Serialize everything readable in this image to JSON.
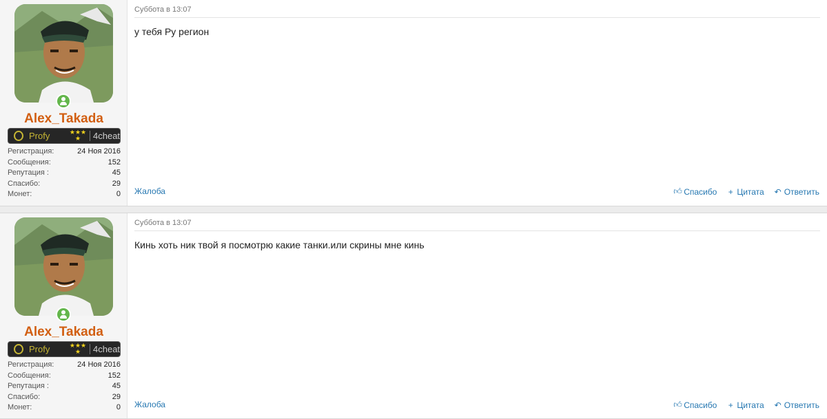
{
  "posts": [
    {
      "user": {
        "name": "Alex_Takada",
        "badge": {
          "rank": "Profy",
          "stars": "★★★",
          "star2": "★",
          "site": "4cheat"
        },
        "stats": [
          {
            "key": "Регистрация:",
            "value": "24 Ноя 2016"
          },
          {
            "key": "Сообщения:",
            "value": "152"
          },
          {
            "key": "Репутация :",
            "value": "45"
          },
          {
            "key": "Спасибо:",
            "value": "29"
          },
          {
            "key": "Монет:",
            "value": "0"
          }
        ]
      },
      "date": "Суббота в 13:07",
      "message": "у тебя Ру регион",
      "report": "Жалоба",
      "actions": {
        "like": "Спасибо",
        "quote": "Цитата",
        "reply": "Ответить"
      }
    },
    {
      "user": {
        "name": "Alex_Takada",
        "badge": {
          "rank": "Profy",
          "stars": "★★★",
          "star2": "★",
          "site": "4cheat"
        },
        "stats": [
          {
            "key": "Регистрация:",
            "value": "24 Ноя 2016"
          },
          {
            "key": "Сообщения:",
            "value": "152"
          },
          {
            "key": "Репутация :",
            "value": "45"
          },
          {
            "key": "Спасибо:",
            "value": "29"
          },
          {
            "key": "Монет:",
            "value": "0"
          }
        ]
      },
      "date": "Суббота в 13:07",
      "message": "Кинь хоть ник твой я посмотрю какие танки.или скрины мне кинь",
      "report": "Жалоба",
      "actions": {
        "like": "Спасибо",
        "quote": "Цитата",
        "reply": "Ответить"
      }
    }
  ],
  "icons": {
    "like": "thumbs-up-icon",
    "quote": "plus-icon",
    "reply": "reply-icon",
    "online": "online-user-icon"
  },
  "colors": {
    "username": "#d25f12",
    "link": "#2577b1",
    "online": "#63b64b",
    "rank": "#c6b634"
  }
}
